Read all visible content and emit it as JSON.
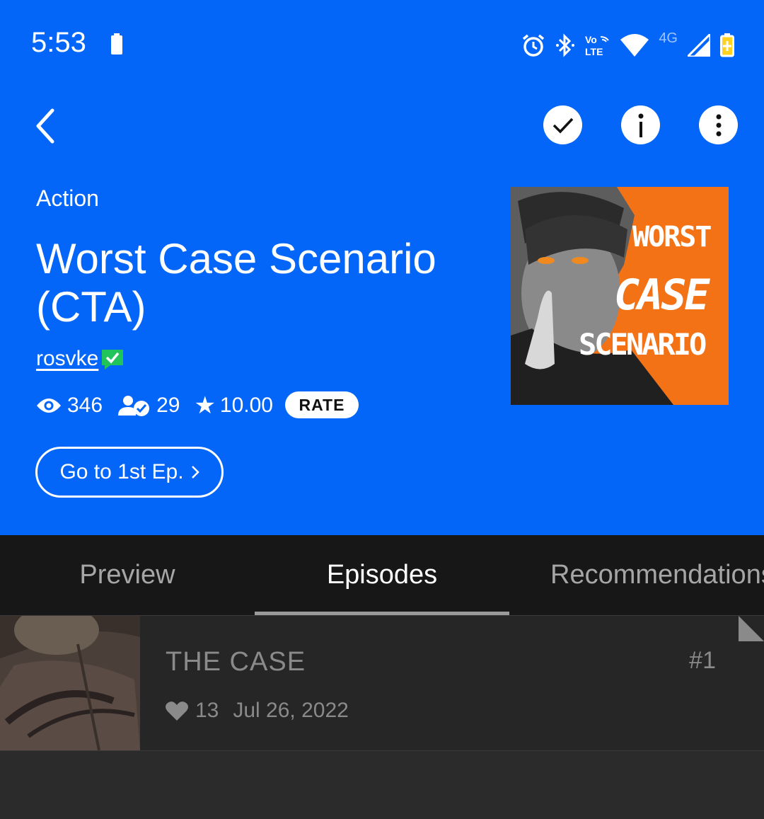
{
  "status_bar": {
    "time": "5:53",
    "network_label": "4G",
    "volte_label": "Vo LTE",
    "icons": [
      "battery-icon",
      "alarm-icon",
      "bluetooth-icon",
      "volte-icon",
      "wifi-icon",
      "signal-icon",
      "battery-charging-icon"
    ]
  },
  "toolbar": {
    "back_icon": "chevron-left-icon",
    "actions": [
      "check-icon",
      "info-icon",
      "more-vertical-icon"
    ]
  },
  "series": {
    "genre": "Action",
    "title": "Worst Case Scenario (CTA)",
    "author": "rosvke",
    "views": "346",
    "subscribers": "29",
    "rating": "10.00",
    "rate_label": "RATE",
    "first_episode_label": "Go to 1st Ep."
  },
  "cover": {
    "lines": [
      "WORST",
      "CASE",
      "SCENARIO"
    ],
    "background": "#f37215"
  },
  "tabs": [
    {
      "label": "Preview",
      "active": false
    },
    {
      "label": "Episodes",
      "active": true
    },
    {
      "label": "Recommendations",
      "active": false
    }
  ],
  "episodes": [
    {
      "title": "THE CASE",
      "number": "#1",
      "likes": "13",
      "date": "Jul 26, 2022"
    }
  ],
  "colors": {
    "header_blue": "#0366f9",
    "tabs_bg": "#171717",
    "list_bg": "#262626",
    "verified_green": "#21c45b"
  }
}
